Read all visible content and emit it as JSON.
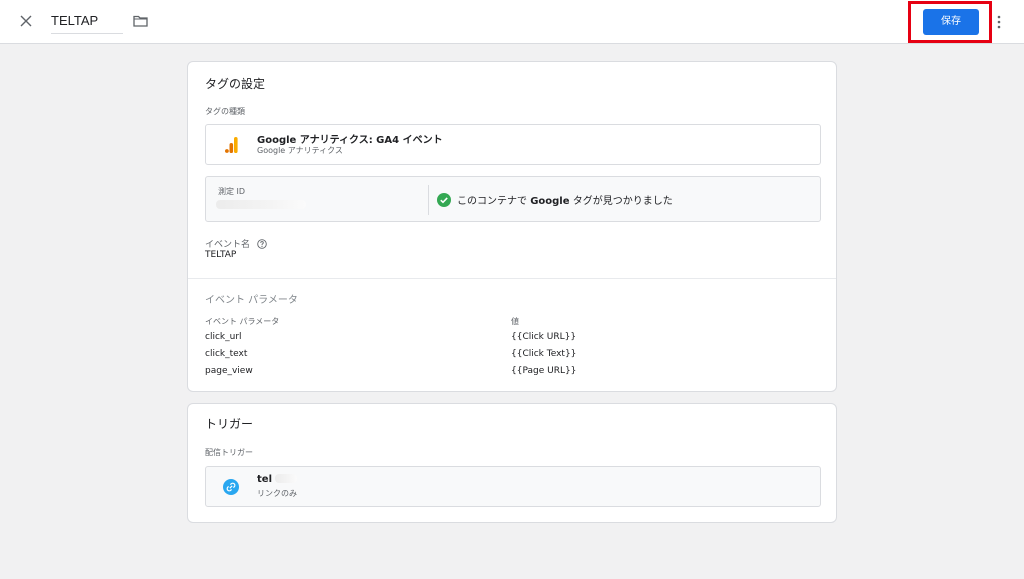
{
  "header": {
    "tag_name": "TELTAP",
    "save_label": "保存"
  },
  "tag_settings": {
    "title": "タグの設定",
    "tag_type_label": "タグの種類",
    "tag_type_name": "Google アナリティクス: GA4 イベント",
    "tag_type_sub": "Google アナリティクス",
    "measurement_id_label": "測定 ID",
    "measurement_status_prefix": "このコンテナで ",
    "measurement_status_bold": "Google",
    "measurement_status_suffix": " タグが見つかりました",
    "event_name_label": "イベント名",
    "event_name_value": "TELTAP",
    "event_params_section": "イベント パラメータ",
    "params_header_name": "イベント パラメータ",
    "params_header_value": "値",
    "params": [
      {
        "name": "click_url",
        "value": "{{Click URL}}"
      },
      {
        "name": "click_text",
        "value": "{{Click Text}}"
      },
      {
        "name": "page_view",
        "value": "{{Page URL}}"
      }
    ]
  },
  "trigger": {
    "title": "トリガー",
    "firing_label": "配信トリガー",
    "trigger_name": "tel",
    "trigger_type": "リンクのみ"
  },
  "colors": {
    "accent": "#1a73e8",
    "highlight": "#e60012",
    "success": "#34a853",
    "link_icon": "#29a7f0",
    "ga_orange": "#f9ab00",
    "ga_dark": "#e37400"
  }
}
